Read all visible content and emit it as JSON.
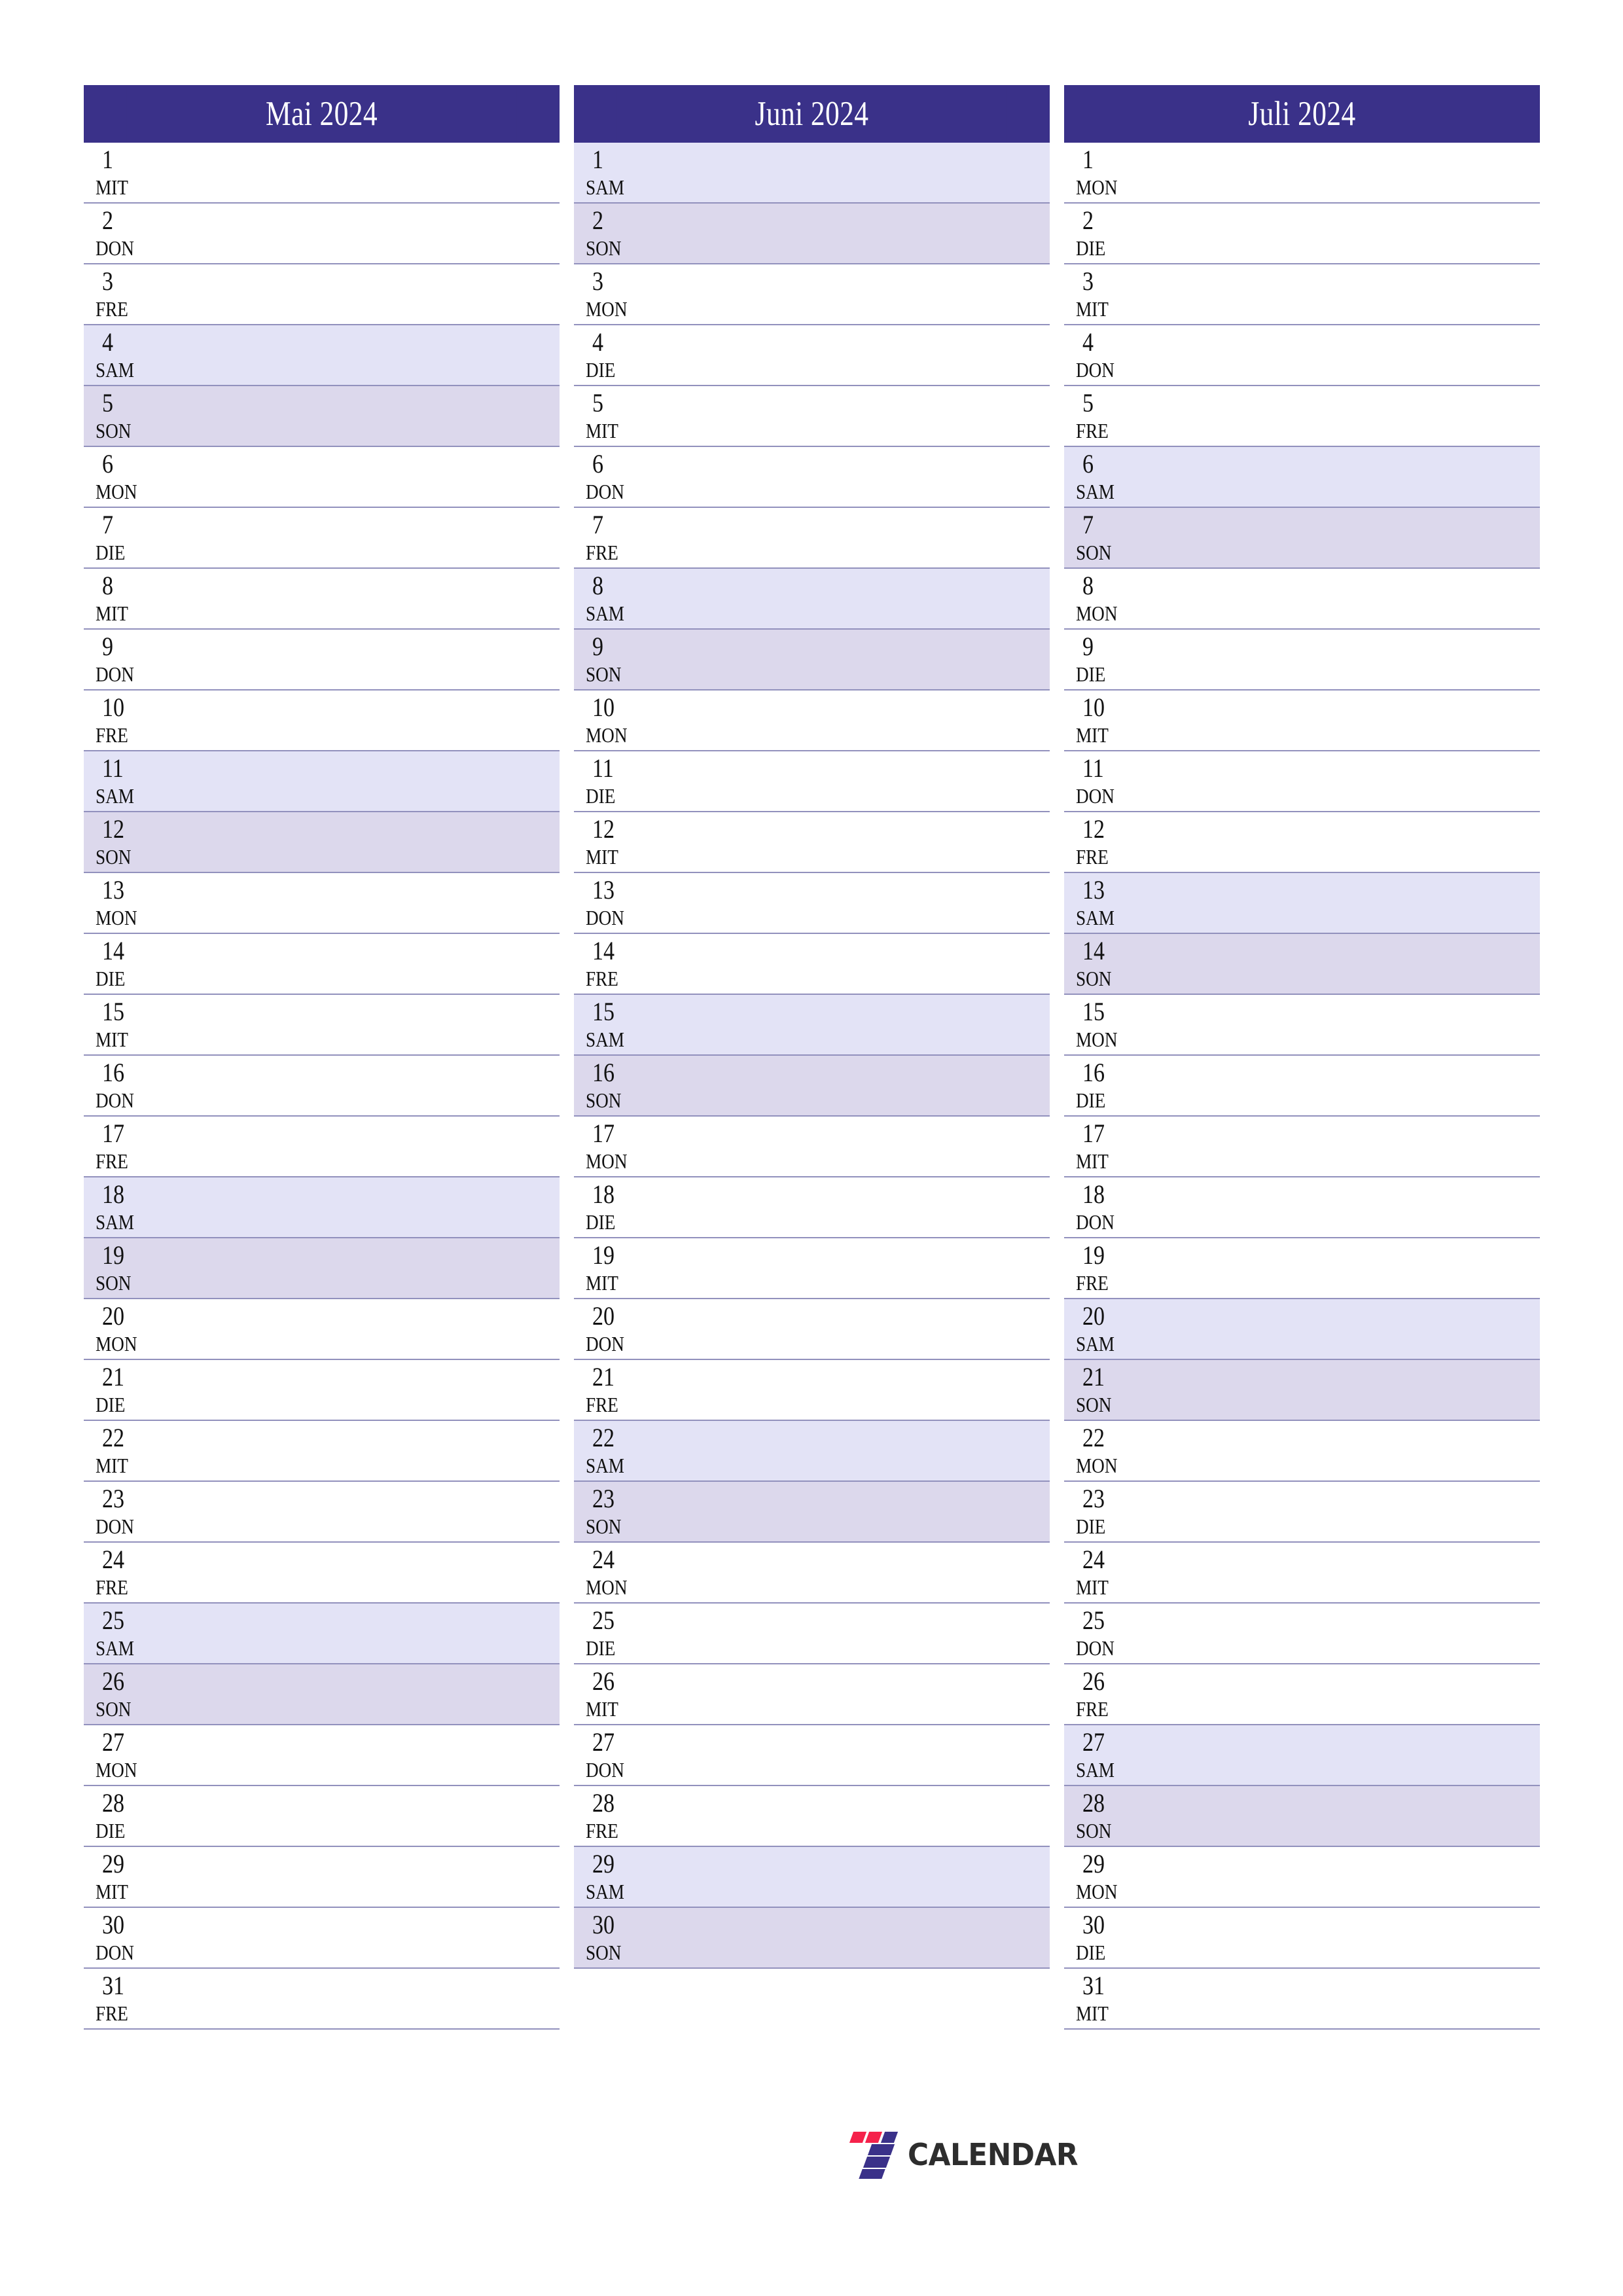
{
  "document": {
    "title": "Mai Juni Juli 2024 Kalender",
    "year": "2024",
    "language": "de"
  },
  "colors": {
    "header_bg": "#3a3189",
    "header_text": "#ffffff",
    "saturday_bg": "#e3e3f6",
    "sunday_bg": "#dcd8ec",
    "row_divider": "#9291bd",
    "day_text": "#111111",
    "page_bg": "#ffffff",
    "logo_red": "#f5224b",
    "logo_indigo": "#3a3189",
    "logo_text": "#2d2d2d"
  },
  "logo": {
    "mark_name": "seven-logo-mark",
    "text": "CALENDAR"
  },
  "months": [
    {
      "name": "Mai 2024",
      "days": [
        {
          "num": "1",
          "wd": "MIT",
          "type": "weekday"
        },
        {
          "num": "2",
          "wd": "DON",
          "type": "weekday"
        },
        {
          "num": "3",
          "wd": "FRE",
          "type": "weekday"
        },
        {
          "num": "4",
          "wd": "SAM",
          "type": "sat"
        },
        {
          "num": "5",
          "wd": "SON",
          "type": "sun"
        },
        {
          "num": "6",
          "wd": "MON",
          "type": "weekday"
        },
        {
          "num": "7",
          "wd": "DIE",
          "type": "weekday"
        },
        {
          "num": "8",
          "wd": "MIT",
          "type": "weekday"
        },
        {
          "num": "9",
          "wd": "DON",
          "type": "weekday"
        },
        {
          "num": "10",
          "wd": "FRE",
          "type": "weekday"
        },
        {
          "num": "11",
          "wd": "SAM",
          "type": "sat"
        },
        {
          "num": "12",
          "wd": "SON",
          "type": "sun"
        },
        {
          "num": "13",
          "wd": "MON",
          "type": "weekday"
        },
        {
          "num": "14",
          "wd": "DIE",
          "type": "weekday"
        },
        {
          "num": "15",
          "wd": "MIT",
          "type": "weekday"
        },
        {
          "num": "16",
          "wd": "DON",
          "type": "weekday"
        },
        {
          "num": "17",
          "wd": "FRE",
          "type": "weekday"
        },
        {
          "num": "18",
          "wd": "SAM",
          "type": "sat"
        },
        {
          "num": "19",
          "wd": "SON",
          "type": "sun"
        },
        {
          "num": "20",
          "wd": "MON",
          "type": "weekday"
        },
        {
          "num": "21",
          "wd": "DIE",
          "type": "weekday"
        },
        {
          "num": "22",
          "wd": "MIT",
          "type": "weekday"
        },
        {
          "num": "23",
          "wd": "DON",
          "type": "weekday"
        },
        {
          "num": "24",
          "wd": "FRE",
          "type": "weekday"
        },
        {
          "num": "25",
          "wd": "SAM",
          "type": "sat"
        },
        {
          "num": "26",
          "wd": "SON",
          "type": "sun"
        },
        {
          "num": "27",
          "wd": "MON",
          "type": "weekday"
        },
        {
          "num": "28",
          "wd": "DIE",
          "type": "weekday"
        },
        {
          "num": "29",
          "wd": "MIT",
          "type": "weekday"
        },
        {
          "num": "30",
          "wd": "DON",
          "type": "weekday"
        },
        {
          "num": "31",
          "wd": "FRE",
          "type": "weekday"
        }
      ]
    },
    {
      "name": "Juni 2024",
      "days": [
        {
          "num": "1",
          "wd": "SAM",
          "type": "sat"
        },
        {
          "num": "2",
          "wd": "SON",
          "type": "sun"
        },
        {
          "num": "3",
          "wd": "MON",
          "type": "weekday"
        },
        {
          "num": "4",
          "wd": "DIE",
          "type": "weekday"
        },
        {
          "num": "5",
          "wd": "MIT",
          "type": "weekday"
        },
        {
          "num": "6",
          "wd": "DON",
          "type": "weekday"
        },
        {
          "num": "7",
          "wd": "FRE",
          "type": "weekday"
        },
        {
          "num": "8",
          "wd": "SAM",
          "type": "sat"
        },
        {
          "num": "9",
          "wd": "SON",
          "type": "sun"
        },
        {
          "num": "10",
          "wd": "MON",
          "type": "weekday"
        },
        {
          "num": "11",
          "wd": "DIE",
          "type": "weekday"
        },
        {
          "num": "12",
          "wd": "MIT",
          "type": "weekday"
        },
        {
          "num": "13",
          "wd": "DON",
          "type": "weekday"
        },
        {
          "num": "14",
          "wd": "FRE",
          "type": "weekday"
        },
        {
          "num": "15",
          "wd": "SAM",
          "type": "sat"
        },
        {
          "num": "16",
          "wd": "SON",
          "type": "sun"
        },
        {
          "num": "17",
          "wd": "MON",
          "type": "weekday"
        },
        {
          "num": "18",
          "wd": "DIE",
          "type": "weekday"
        },
        {
          "num": "19",
          "wd": "MIT",
          "type": "weekday"
        },
        {
          "num": "20",
          "wd": "DON",
          "type": "weekday"
        },
        {
          "num": "21",
          "wd": "FRE",
          "type": "weekday"
        },
        {
          "num": "22",
          "wd": "SAM",
          "type": "sat"
        },
        {
          "num": "23",
          "wd": "SON",
          "type": "sun"
        },
        {
          "num": "24",
          "wd": "MON",
          "type": "weekday"
        },
        {
          "num": "25",
          "wd": "DIE",
          "type": "weekday"
        },
        {
          "num": "26",
          "wd": "MIT",
          "type": "weekday"
        },
        {
          "num": "27",
          "wd": "DON",
          "type": "weekday"
        },
        {
          "num": "28",
          "wd": "FRE",
          "type": "weekday"
        },
        {
          "num": "29",
          "wd": "SAM",
          "type": "sat"
        },
        {
          "num": "30",
          "wd": "SON",
          "type": "sun"
        }
      ]
    },
    {
      "name": "Juli 2024",
      "days": [
        {
          "num": "1",
          "wd": "MON",
          "type": "weekday"
        },
        {
          "num": "2",
          "wd": "DIE",
          "type": "weekday"
        },
        {
          "num": "3",
          "wd": "MIT",
          "type": "weekday"
        },
        {
          "num": "4",
          "wd": "DON",
          "type": "weekday"
        },
        {
          "num": "5",
          "wd": "FRE",
          "type": "weekday"
        },
        {
          "num": "6",
          "wd": "SAM",
          "type": "sat"
        },
        {
          "num": "7",
          "wd": "SON",
          "type": "sun"
        },
        {
          "num": "8",
          "wd": "MON",
          "type": "weekday"
        },
        {
          "num": "9",
          "wd": "DIE",
          "type": "weekday"
        },
        {
          "num": "10",
          "wd": "MIT",
          "type": "weekday"
        },
        {
          "num": "11",
          "wd": "DON",
          "type": "weekday"
        },
        {
          "num": "12",
          "wd": "FRE",
          "type": "weekday"
        },
        {
          "num": "13",
          "wd": "SAM",
          "type": "sat"
        },
        {
          "num": "14",
          "wd": "SON",
          "type": "sun"
        },
        {
          "num": "15",
          "wd": "MON",
          "type": "weekday"
        },
        {
          "num": "16",
          "wd": "DIE",
          "type": "weekday"
        },
        {
          "num": "17",
          "wd": "MIT",
          "type": "weekday"
        },
        {
          "num": "18",
          "wd": "DON",
          "type": "weekday"
        },
        {
          "num": "19",
          "wd": "FRE",
          "type": "weekday"
        },
        {
          "num": "20",
          "wd": "SAM",
          "type": "sat"
        },
        {
          "num": "21",
          "wd": "SON",
          "type": "sun"
        },
        {
          "num": "22",
          "wd": "MON",
          "type": "weekday"
        },
        {
          "num": "23",
          "wd": "DIE",
          "type": "weekday"
        },
        {
          "num": "24",
          "wd": "MIT",
          "type": "weekday"
        },
        {
          "num": "25",
          "wd": "DON",
          "type": "weekday"
        },
        {
          "num": "26",
          "wd": "FRE",
          "type": "weekday"
        },
        {
          "num": "27",
          "wd": "SAM",
          "type": "sat"
        },
        {
          "num": "28",
          "wd": "SON",
          "type": "sun"
        },
        {
          "num": "29",
          "wd": "MON",
          "type": "weekday"
        },
        {
          "num": "30",
          "wd": "DIE",
          "type": "weekday"
        },
        {
          "num": "31",
          "wd": "MIT",
          "type": "weekday"
        }
      ]
    }
  ]
}
